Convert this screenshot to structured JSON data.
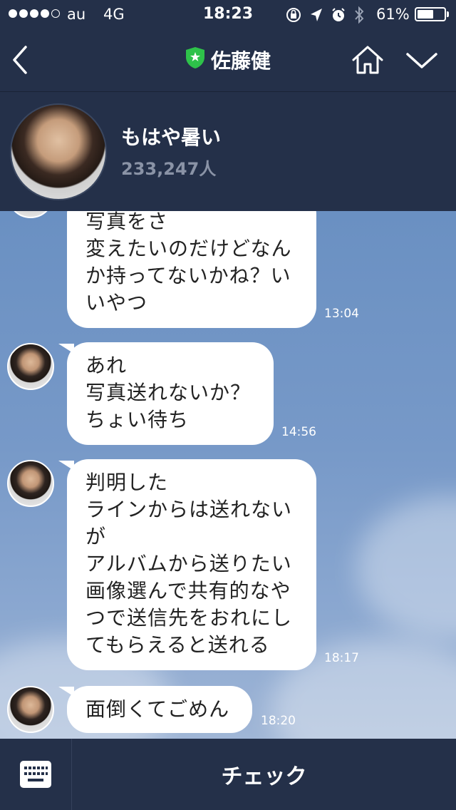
{
  "status_bar": {
    "carrier": "au",
    "network": "4G",
    "time": "18:23",
    "battery_percent_label": "61%",
    "battery_level": 0.61,
    "icons": [
      "orientation-lock-icon",
      "location-arrow-icon",
      "alarm-icon",
      "bluetooth-icon"
    ]
  },
  "header": {
    "title": "佐藤健",
    "badge_color": "#2ec24a",
    "icons": [
      "back-chevron-icon",
      "official-shield-icon",
      "home-icon",
      "chevron-down-icon"
    ]
  },
  "profile": {
    "status_message": "もはや暑い",
    "follower_count": "233,247人"
  },
  "messages": [
    {
      "text": "写真をさ\n変えたいのだけどなん\nか持ってないかね？い\nいやつ",
      "time": "13:04"
    },
    {
      "text": "あれ\n写真送れないか？\nちょい待ち",
      "time": "14:56"
    },
    {
      "text": "判明した\nラインからは送れない\nが\nアルバムから送りたい\n画像選んで共有的なや\nつで送信先をおれにし\nてもらえると送れる",
      "time": "18:17"
    },
    {
      "text": "面倒くてごめん",
      "time": "18:20"
    }
  ],
  "bottom_bar": {
    "check_label": "チェック",
    "keyboard_icon": "keyboard-icon"
  },
  "colors": {
    "bar_background": "#243049",
    "chat_background": "#7799c8",
    "bubble": "#ffffff",
    "muted_text": "#8a93a6"
  }
}
